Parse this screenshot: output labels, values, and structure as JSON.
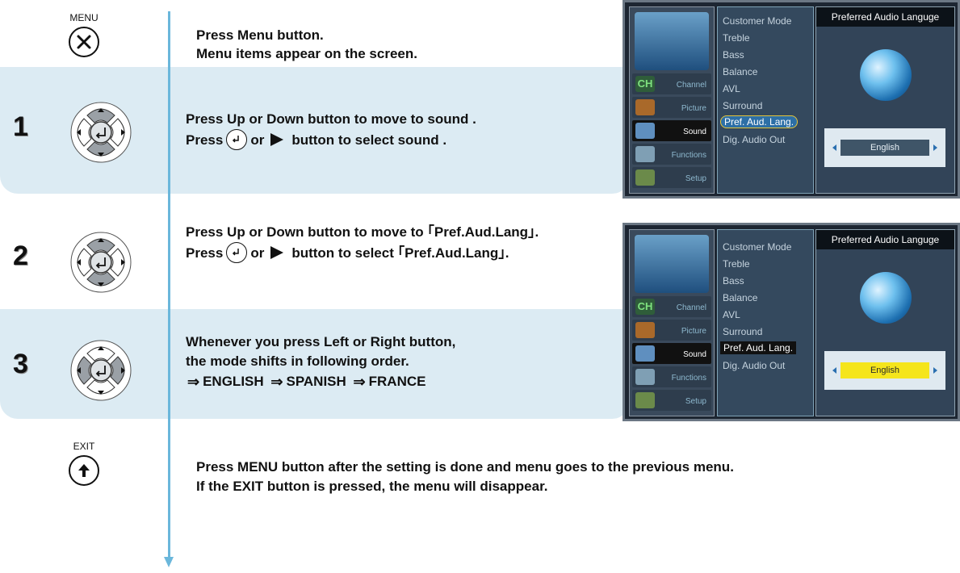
{
  "intro": {
    "button_label": "MENU",
    "line1": "Press Menu button.",
    "line2": "Menu items appear on the screen."
  },
  "step1": {
    "number": "1",
    "line1": "Press Up or Down button to move to sound .",
    "line2_a": "Press",
    "line2_b": "or",
    "line2_c": "button to select sound ."
  },
  "step2": {
    "number": "2",
    "line1": "Press Up or Down button to move to ｢Pref.Aud.Lang｣.",
    "line2_a": "Press",
    "line2_b": "or",
    "line2_c": "button to select ｢Pref.Aud.Lang｣."
  },
  "step3": {
    "number": "3",
    "line1": "Whenever you press Left or Right button,",
    "line2": "the mode shifts in following order.",
    "seq": [
      "ENGLISH",
      "SPANISH",
      "FRANCE"
    ]
  },
  "exit": {
    "button_label": "EXIT",
    "line1": "Press MENU button after the setting is done and menu goes to the previous menu.",
    "line2": "If the EXIT button is pressed, the menu will disappear."
  },
  "tv": {
    "side_items": [
      "Channel",
      "Picture",
      "Sound",
      "Functions",
      "Setup"
    ],
    "side_badge_ch": "CH",
    "menu_items": [
      "Customer Mode",
      "Treble",
      "Bass",
      "Balance",
      "AVL",
      "Surround",
      "Pref. Aud. Lang.",
      "Dig. Audio Out"
    ],
    "panel_title": "Preferred Audio Languge",
    "language_value": "English"
  },
  "colors": {
    "band": "#dcebf3",
    "flow_line": "#6bb7db",
    "highlight_yellow": "#f5e51c"
  }
}
